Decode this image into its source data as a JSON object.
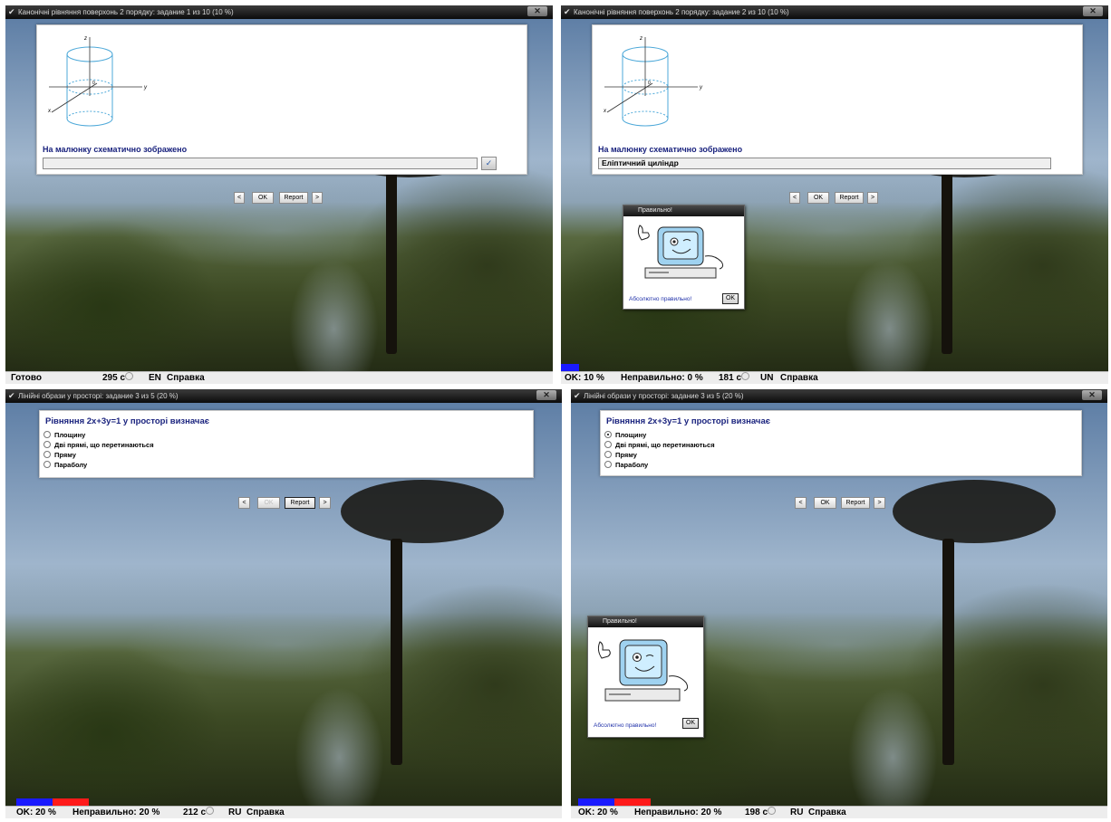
{
  "panels": [
    {
      "title": "Канонічні рівняння поверхонь 2 порядку: задание 1 из 10 (10 %)",
      "question": "На малюнку схематично зображено",
      "answer": "",
      "nav": {
        "prev": "<",
        "ok": "OK",
        "report": "Report",
        "next": ">"
      },
      "status": {
        "left": "Готово",
        "time": "295 с",
        "lang": "EN",
        "help": "Справка"
      }
    },
    {
      "title": "Канонічні рівняння поверхонь 2 порядку: задание 2 из 10 (10 %)",
      "question": "На малюнку схематично зображено",
      "answer": "Еліптичний циліндр",
      "nav": {
        "prev": "<",
        "ok": "OK",
        "report": "Report",
        "next": ">"
      },
      "dialog": {
        "title": "Правильно!",
        "message": "Абсолютно правильно!",
        "ok": "OK"
      },
      "status": {
        "ok": "OK: 10 %",
        "wrong": "Неправильно: 0 %",
        "time": "181 с",
        "lang": "UN",
        "help": "Справка"
      }
    },
    {
      "title": "Лінійні образи у просторі: задание 3 из 5 (20 %)",
      "question": "Рівняння 2x+3y=1 у просторі визначає",
      "options": [
        "Площину",
        "Дві прямі, що перетинаються",
        "Пряму",
        "Параболу"
      ],
      "selected": -1,
      "nav": {
        "prev": "<",
        "ok": "OK",
        "report": "Report",
        "next": ">"
      },
      "status": {
        "ok": "OK: 20 %",
        "wrong": "Неправильно: 20 %",
        "time": "212 с",
        "lang": "RU",
        "help": "Справка"
      }
    },
    {
      "title": "Лінійні образи у просторі: задание 3 из 5 (20 %)",
      "question": "Рівняння 2x+3y=1 у просторі визначає",
      "options": [
        "Площину",
        "Дві прямі, що перетинаються",
        "Пряму",
        "Параболу"
      ],
      "selected": 0,
      "nav": {
        "prev": "<",
        "ok": "OK",
        "report": "Report",
        "next": ">"
      },
      "dialog": {
        "title": "Правильно!",
        "message": "Абсолютно правильно!",
        "ok": "OK"
      },
      "status": {
        "ok": "OK: 20 %",
        "wrong": "Неправильно: 20 %",
        "time": "198 с",
        "lang": "RU",
        "help": "Справка"
      }
    }
  ],
  "axes": {
    "z": "z",
    "y": "y",
    "x": "x",
    "origin": "0"
  },
  "colors": {
    "question": "#1a237e",
    "progress_ok": "#1a1aff",
    "progress_wrong": "#ff1a1a",
    "cylinder": "#4ea9d9"
  },
  "progress": {
    "panel2": {
      "ok_fraction": 0.1,
      "wrong_fraction": 0.0
    },
    "panel3": {
      "ok_fraction": 0.2,
      "wrong_fraction": 0.2
    },
    "panel4": {
      "ok_fraction": 0.2,
      "wrong_fraction": 0.2
    }
  }
}
